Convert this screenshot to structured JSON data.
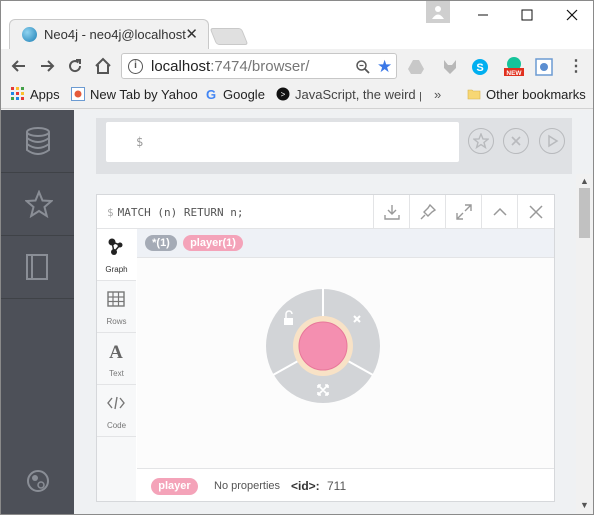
{
  "browser": {
    "tab_title": "Neo4j - neo4j@localhost",
    "tab_close": "✕",
    "url_host": "localhost",
    "url_path": ":7474/browser/",
    "menu_glyph": "⋮",
    "star_glyph": "★"
  },
  "bookmarks": {
    "items": [
      {
        "label": "Apps",
        "icon": "apps-grid-icon"
      },
      {
        "label": "New Tab by Yahoo",
        "icon": "yahoo-icon"
      },
      {
        "label": "Google",
        "icon": "google-icon"
      },
      {
        "label": "JavaScript, the weird p",
        "icon": "js-icon"
      }
    ],
    "more": "»",
    "other": "Other bookmarks"
  },
  "extensions": {
    "new_badge": "NEW"
  },
  "editor": {
    "prompt": "$"
  },
  "frame": {
    "query": "MATCH (n) RETURN n;",
    "dollar": "$",
    "views": [
      {
        "label": "Graph"
      },
      {
        "label": "Rows"
      },
      {
        "label": "Text"
      },
      {
        "label": "Code"
      }
    ],
    "labels": [
      {
        "text": "*(1)",
        "color": "#a5abb6"
      },
      {
        "text": "player(1)",
        "color": "#f4a3b9"
      }
    ],
    "node": {
      "fill": "#f48fb0",
      "ring": "#f8e2c6"
    }
  },
  "footer": {
    "label": "player",
    "props": "No properties",
    "id_key": "<id>:",
    "id_val": "711"
  },
  "colors": {
    "sidebar": "#4d5058",
    "accent_pink": "#f4a3b9",
    "gray_pill": "#a5abb6"
  }
}
